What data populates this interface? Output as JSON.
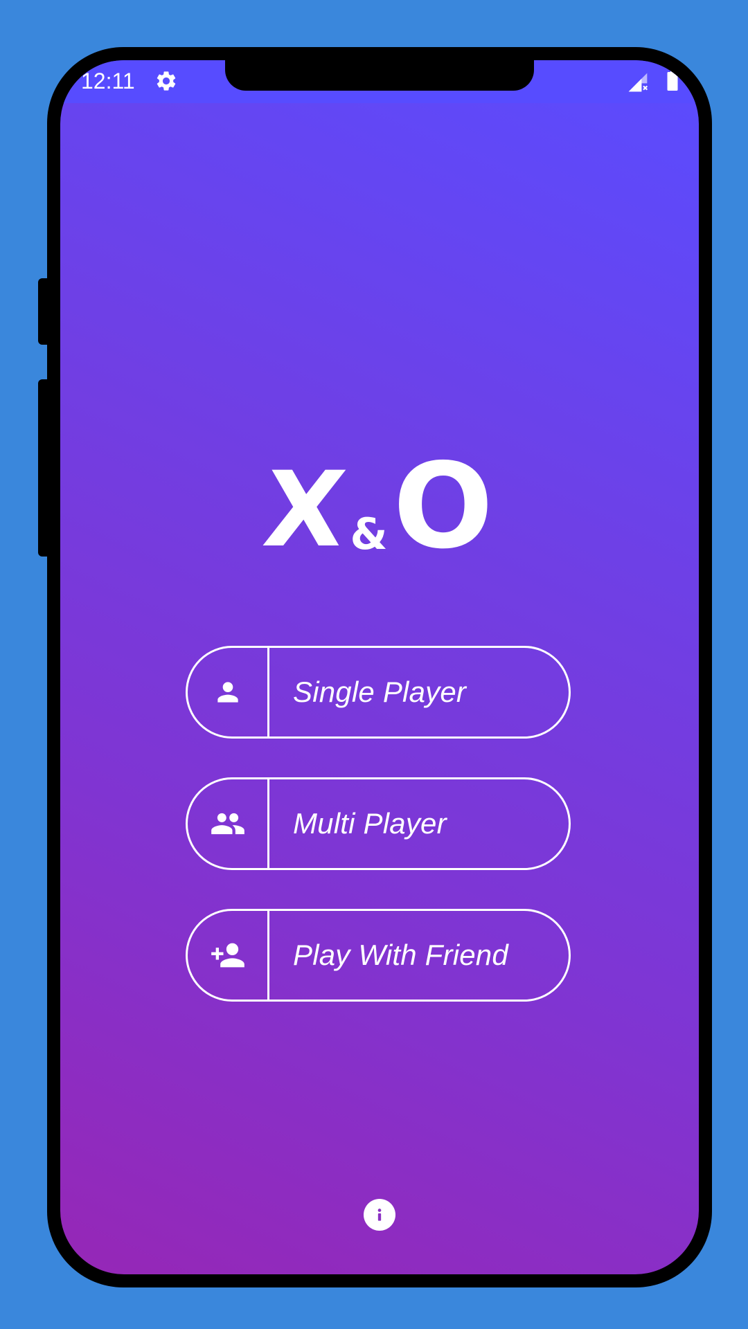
{
  "status_bar": {
    "time": "12:11",
    "icons": [
      "settings-icon",
      "signal-no-sim-icon",
      "battery-icon"
    ]
  },
  "logo": {
    "x": "X",
    "amp": "&",
    "o": "O"
  },
  "menu": [
    {
      "label": "Single Player",
      "icon": "person-icon"
    },
    {
      "label": "Multi Player",
      "icon": "group-icon"
    },
    {
      "label": "Play With Friend",
      "icon": "person-add-icon"
    }
  ],
  "footer": {
    "info_icon": "info-icon"
  },
  "colors": {
    "page_background": "#3a87dc",
    "status_bar": "#574cff",
    "gradient_top": "#5a4cff",
    "gradient_bottom": "#9627b6",
    "foreground": "#ffffff"
  }
}
